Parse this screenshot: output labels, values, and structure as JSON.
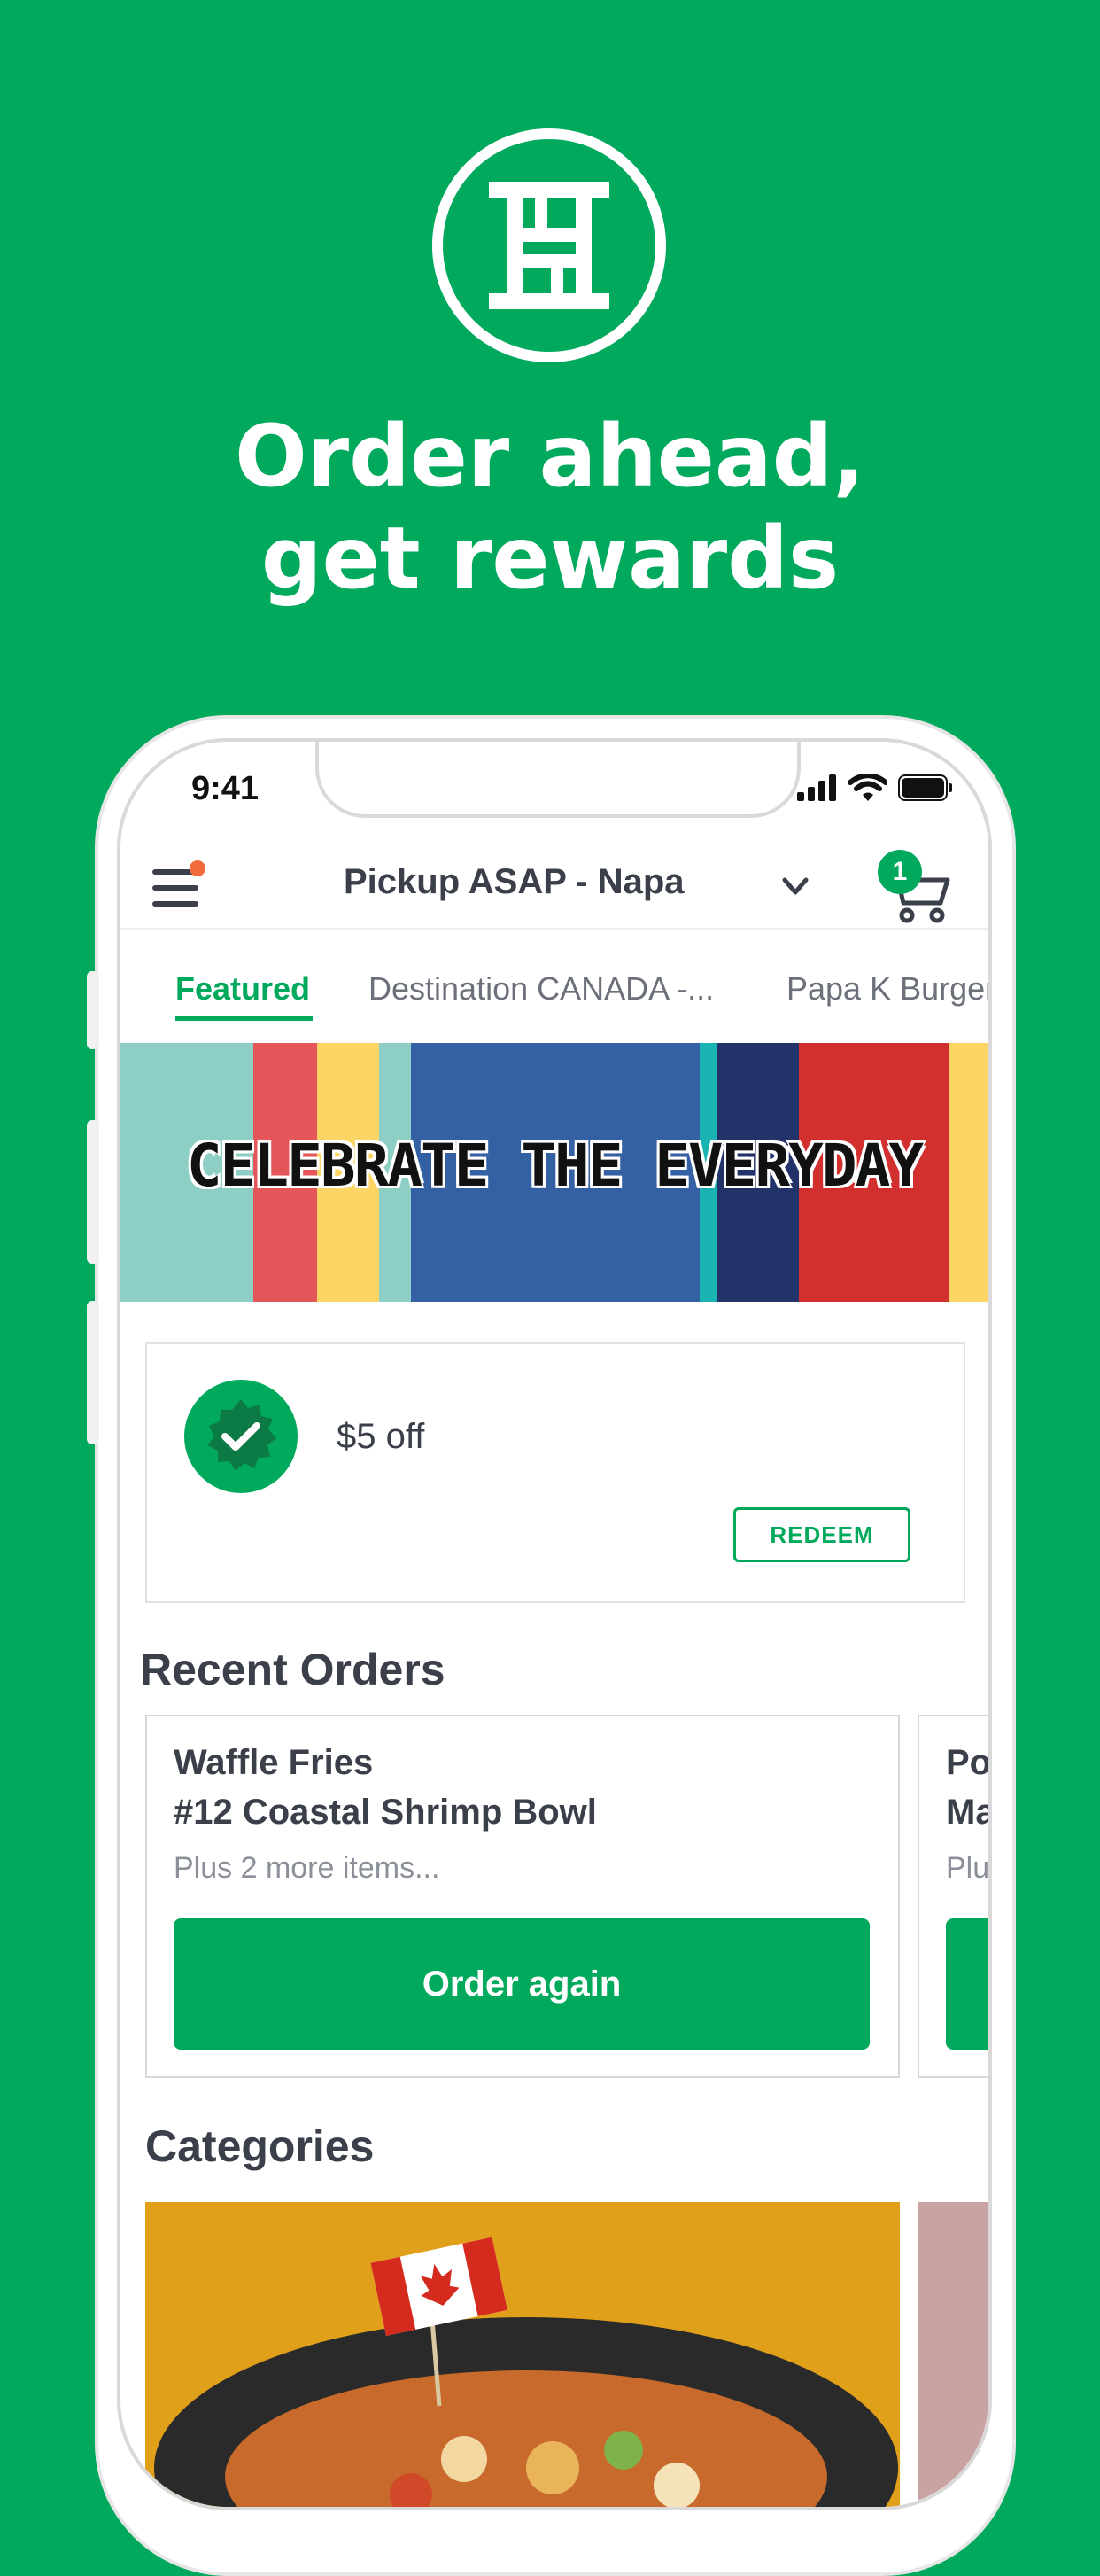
{
  "headline": {
    "line1": "Order ahead,",
    "line2": "get rewards"
  },
  "colors": {
    "brand_green": "#00A95C",
    "notification_dot": "#F26B3A",
    "text_dark": "#3a3f4a"
  },
  "status_bar": {
    "time": "9:41",
    "icons": [
      "signal-icon",
      "wifi-icon",
      "battery-icon"
    ]
  },
  "app_bar": {
    "location": "Pickup ASAP - Napa",
    "cart_count": "1"
  },
  "tabs": [
    {
      "label": "Featured",
      "active": true
    },
    {
      "label": "Destination CANADA -..."
    },
    {
      "label": "Papa K Burger"
    }
  ],
  "banner": {
    "text": "CELEBRATE THE EVERYDAY"
  },
  "reward": {
    "label": "$5 off",
    "button": "REDEEM"
  },
  "recent_orders": {
    "title": "Recent Orders",
    "orders": [
      {
        "line1": "Waffle Fries",
        "line2": "#12 Coastal Shrimp Bowl",
        "more": "Plus 2 more items...",
        "button": "Order again"
      },
      {
        "line1": "Po",
        "line2": "Ma",
        "more": "Plu",
        "button": ""
      }
    ]
  },
  "categories": {
    "title": "Categories"
  }
}
